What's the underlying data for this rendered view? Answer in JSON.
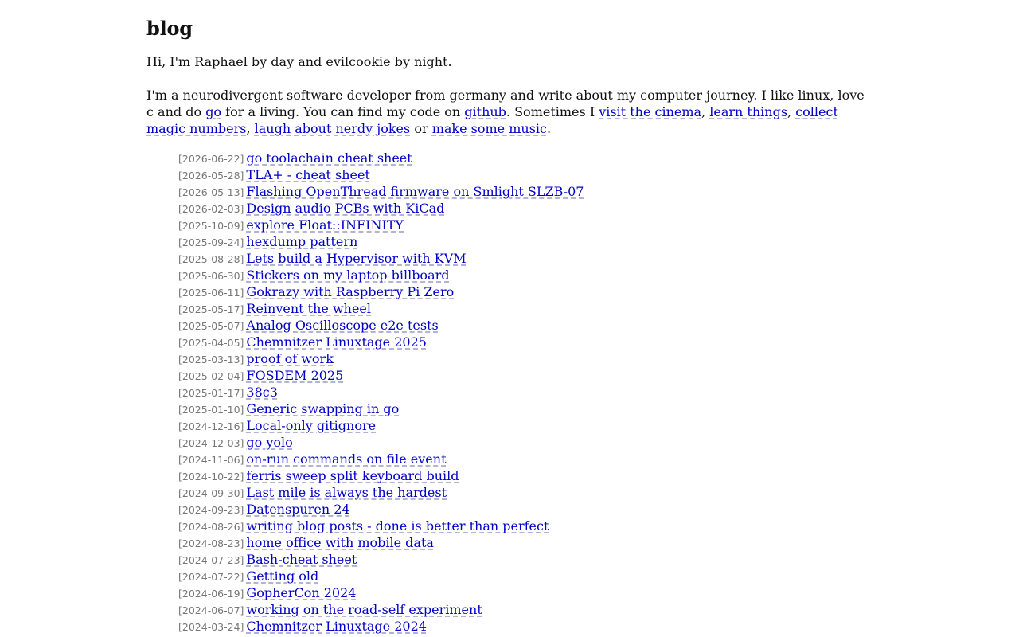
{
  "header": {
    "title": "blog"
  },
  "intro": {
    "greeting": "Hi, I'm Raphael by day and evilcookie by night.",
    "about_text_1": "I'm a neurodivergent software developer from germany and write about my computer journey. I like linux, love c and do ",
    "link_go": "go",
    "about_text_2": " for a living. You can find my code on ",
    "link_github": "github",
    "about_text_3": ". Sometimes I ",
    "link_cinema": "visit the cinema",
    "sep_1": ", ",
    "link_learn": "learn things",
    "sep_2": ", ",
    "link_magic": "collect magic numbers",
    "sep_3": ", ",
    "link_jokes": "laugh about nerdy jokes",
    "sep_4": " or ",
    "link_music": "make some music",
    "about_end": "."
  },
  "posts": [
    {
      "date": "[2026-06-22]",
      "title": "go toolachain cheat sheet"
    },
    {
      "date": "[2026-05-28]",
      "title": "TLA+ - cheat sheet"
    },
    {
      "date": "[2026-05-13]",
      "title": "Flashing OpenThread firmware on Smlight SLZB-07"
    },
    {
      "date": "[2026-02-03]",
      "title": "Design audio PCBs with KiCad"
    },
    {
      "date": "[2025-10-09]",
      "title": "explore Float::INFINITY"
    },
    {
      "date": "[2025-09-24]",
      "title": "hexdump pattern"
    },
    {
      "date": "[2025-08-28]",
      "title": "Lets build a Hypervisor with KVM"
    },
    {
      "date": "[2025-06-30]",
      "title": "Stickers on my laptop billboard"
    },
    {
      "date": "[2025-06-11]",
      "title": "Gokrazy with Raspberry Pi Zero"
    },
    {
      "date": "[2025-05-17]",
      "title": "Reinvent the wheel"
    },
    {
      "date": "[2025-05-07]",
      "title": "Analog Oscilloscope e2e tests"
    },
    {
      "date": "[2025-04-05]",
      "title": "Chemnitzer Linuxtage 2025"
    },
    {
      "date": "[2025-03-13]",
      "title": "proof of work"
    },
    {
      "date": "[2025-02-04]",
      "title": "FOSDEM 2025"
    },
    {
      "date": "[2025-01-17]",
      "title": "38c3"
    },
    {
      "date": "[2025-01-10]",
      "title": "Generic swapping in go"
    },
    {
      "date": "[2024-12-16]",
      "title": "Local-only gitignore"
    },
    {
      "date": "[2024-12-03]",
      "title": "go yolo"
    },
    {
      "date": "[2024-11-06]",
      "title": "on-run commands on file event"
    },
    {
      "date": "[2024-10-22]",
      "title": "ferris sweep split keyboard build"
    },
    {
      "date": "[2024-09-30]",
      "title": "Last mile is always the hardest"
    },
    {
      "date": "[2024-09-23]",
      "title": "Datenspuren 24"
    },
    {
      "date": "[2024-08-26]",
      "title": "writing blog posts - done is better than perfect"
    },
    {
      "date": "[2024-08-23]",
      "title": "home office with mobile data"
    },
    {
      "date": "[2024-07-23]",
      "title": "Bash-cheat sheet"
    },
    {
      "date": "[2024-07-22]",
      "title": "Getting old"
    },
    {
      "date": "[2024-06-19]",
      "title": "GopherCon 2024"
    },
    {
      "date": "[2024-06-07]",
      "title": "working on the road-self experiment"
    },
    {
      "date": "[2024-03-24]",
      "title": "Chemnitzer Linuxtage 2024"
    }
  ]
}
